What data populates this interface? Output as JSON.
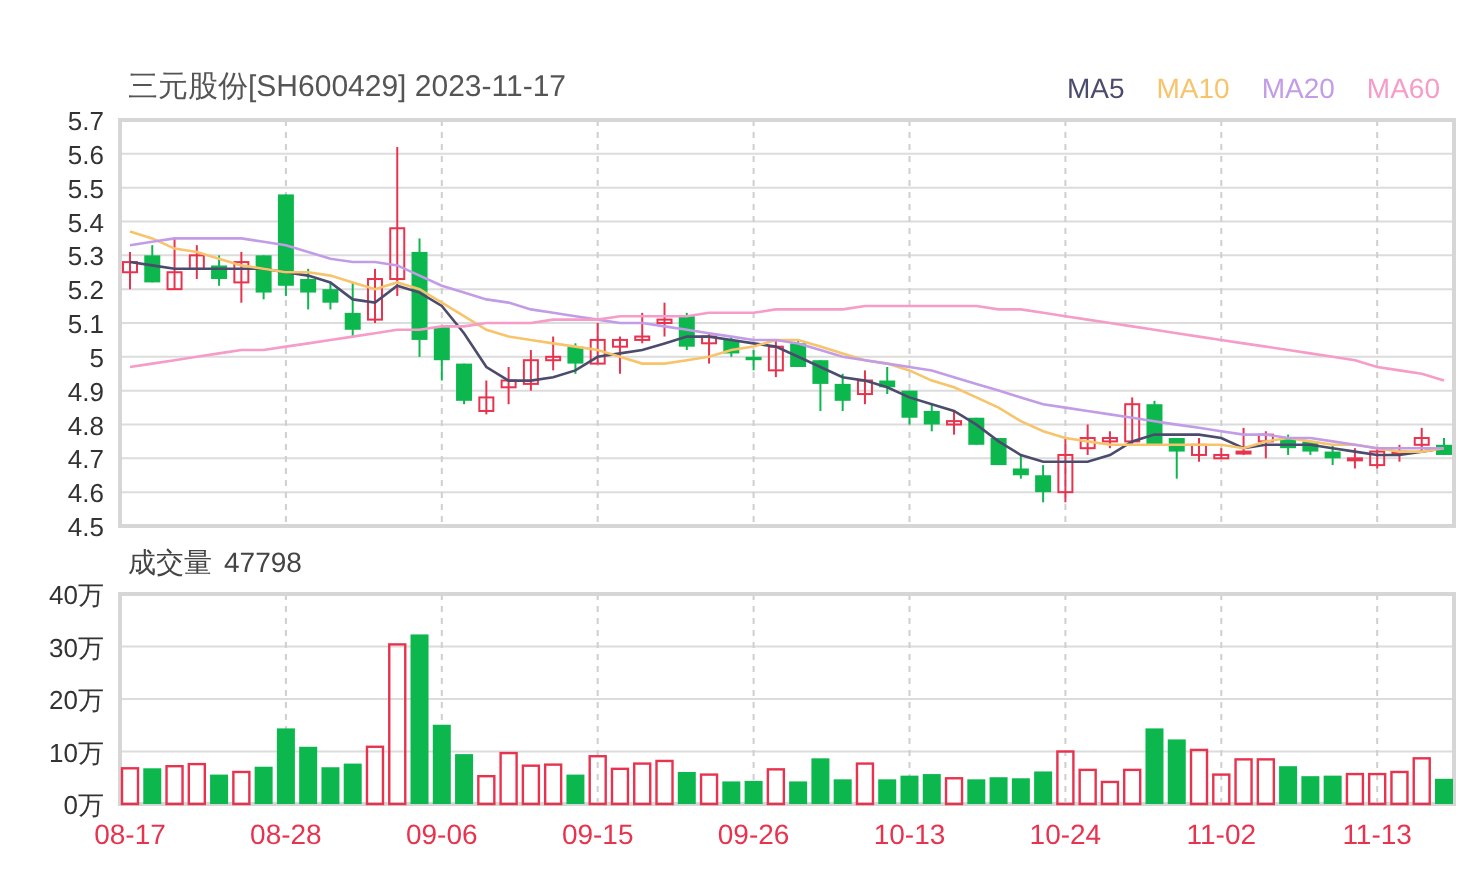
{
  "header": {
    "title": "三元股份[SH600429] 2023-11-17"
  },
  "price_chart": {
    "candles": {
      "chart_data": {
        "type": "candlestick",
        "grid": true,
        "categories": [
          null,
          null,
          null,
          null,
          null,
          null,
          null,
          null,
          null,
          null,
          null,
          null,
          null,
          null,
          null,
          null,
          null,
          null,
          null,
          null,
          null,
          null,
          null,
          null,
          null,
          null,
          null,
          null,
          null,
          null,
          null,
          null,
          null,
          null,
          null,
          null,
          null,
          null,
          null,
          null,
          null,
          null,
          null,
          null,
          null,
          null,
          null,
          null,
          null,
          null,
          null,
          null,
          null,
          null,
          null,
          null,
          null,
          null,
          null,
          null
        ],
        "ylim": [
          4.5,
          5.7
        ],
        "yticks": [
          {
            "value": 5.7,
            "label": "5.7"
          },
          {
            "value": 5.6,
            "label": "5.6"
          },
          {
            "value": 5.5,
            "label": "5.5"
          },
          {
            "value": 5.4,
            "label": "5.4"
          },
          {
            "value": 5.3,
            "label": "5.3"
          },
          {
            "value": 5.2,
            "label": "5.2"
          },
          {
            "value": 5.1,
            "label": "5.1"
          },
          {
            "value": 5,
            "label": "5"
          },
          {
            "value": 4.9,
            "label": "4.9"
          },
          {
            "value": 4.8,
            "label": "4.8"
          },
          {
            "value": 4.7,
            "label": "4.7"
          },
          {
            "value": 4.6,
            "label": "4.6"
          },
          {
            "value": 4.5,
            "label": "4.5"
          }
        ],
        "ohlc": [
          [
            5.25,
            5.31,
            5.2,
            5.28
          ],
          [
            5.3,
            5.33,
            5.22,
            5.22
          ],
          [
            5.2,
            5.35,
            5.2,
            5.25
          ],
          [
            5.26,
            5.33,
            5.23,
            5.3
          ],
          [
            5.27,
            5.3,
            5.21,
            5.23
          ],
          [
            5.22,
            5.31,
            5.16,
            5.28
          ],
          [
            5.3,
            5.3,
            5.17,
            5.19
          ],
          [
            5.48,
            5.48,
            5.18,
            5.21
          ],
          [
            5.23,
            5.26,
            5.14,
            5.19
          ],
          [
            5.2,
            5.22,
            5.14,
            5.16
          ],
          [
            5.13,
            5.22,
            5.06,
            5.08
          ],
          [
            5.11,
            5.26,
            5.1,
            5.23
          ],
          [
            5.23,
            5.62,
            5.18,
            5.38
          ],
          [
            5.31,
            5.35,
            5.0,
            5.05
          ],
          [
            5.09,
            5.09,
            4.93,
            4.99
          ],
          [
            4.98,
            4.98,
            4.86,
            4.87
          ],
          [
            4.84,
            4.93,
            4.83,
            4.88
          ],
          [
            4.91,
            4.97,
            4.86,
            4.93
          ],
          [
            4.92,
            5.02,
            4.9,
            4.99
          ],
          [
            4.99,
            5.06,
            4.96,
            5.0
          ],
          [
            5.03,
            5.04,
            4.95,
            4.98
          ],
          [
            4.98,
            5.1,
            4.98,
            5.05
          ],
          [
            5.03,
            5.06,
            4.95,
            5.05
          ],
          [
            5.05,
            5.13,
            5.04,
            5.06
          ],
          [
            5.1,
            5.16,
            5.06,
            5.11
          ],
          [
            5.12,
            5.13,
            5.02,
            5.03
          ],
          [
            5.04,
            5.07,
            4.98,
            5.06
          ],
          [
            5.05,
            5.06,
            5.0,
            5.01
          ],
          [
            5.0,
            5.02,
            4.96,
            4.99
          ],
          [
            4.96,
            5.05,
            4.94,
            5.03
          ],
          [
            5.04,
            5.05,
            4.97,
            4.97
          ],
          [
            4.99,
            4.99,
            4.84,
            4.92
          ],
          [
            4.92,
            4.95,
            4.84,
            4.87
          ],
          [
            4.89,
            4.96,
            4.86,
            4.93
          ],
          [
            4.93,
            4.97,
            4.89,
            4.91
          ],
          [
            4.9,
            4.9,
            4.8,
            4.82
          ],
          [
            4.84,
            4.86,
            4.78,
            4.8
          ],
          [
            4.8,
            4.84,
            4.77,
            4.81
          ],
          [
            4.82,
            4.82,
            4.74,
            4.74
          ],
          [
            4.76,
            4.76,
            4.68,
            4.68
          ],
          [
            4.67,
            4.71,
            4.64,
            4.65
          ],
          [
            4.65,
            4.68,
            4.57,
            4.6
          ],
          [
            4.6,
            4.76,
            4.57,
            4.71
          ],
          [
            4.73,
            4.8,
            4.71,
            4.76
          ],
          [
            4.75,
            4.78,
            4.73,
            4.76
          ],
          [
            4.75,
            4.88,
            4.74,
            4.86
          ],
          [
            4.86,
            4.87,
            4.74,
            4.74
          ],
          [
            4.76,
            4.76,
            4.64,
            4.72
          ],
          [
            4.71,
            4.76,
            4.69,
            4.74
          ],
          [
            4.7,
            4.73,
            4.7,
            4.71
          ],
          [
            4.72,
            4.79,
            4.71,
            4.72
          ],
          [
            4.75,
            4.78,
            4.7,
            4.77
          ],
          [
            4.76,
            4.77,
            4.71,
            4.73
          ],
          [
            4.75,
            4.75,
            4.71,
            4.72
          ],
          [
            4.72,
            4.74,
            4.68,
            4.7
          ],
          [
            4.7,
            4.73,
            4.67,
            4.7
          ],
          [
            4.68,
            4.73,
            4.67,
            4.72
          ],
          [
            4.72,
            4.74,
            4.69,
            4.72
          ],
          [
            4.74,
            4.79,
            4.72,
            4.76
          ],
          [
            4.74,
            4.76,
            4.71,
            4.71
          ]
        ]
      }
    },
    "moving_averages": {
      "chart_data": {
        "type": "line",
        "categories": [
          null,
          null,
          null,
          null,
          null,
          null,
          null,
          null,
          null,
          null,
          null,
          null,
          null,
          null,
          null,
          null,
          null,
          null,
          null,
          null,
          null,
          null,
          null,
          null,
          null,
          null,
          null,
          null,
          null,
          null,
          null,
          null,
          null,
          null,
          null,
          null,
          null,
          null,
          null,
          null,
          null,
          null,
          null,
          null,
          null,
          null,
          null,
          null,
          null,
          null,
          null,
          null,
          null,
          null,
          null,
          null,
          null,
          null,
          null,
          null
        ],
        "ylim": [
          4.5,
          5.7
        ],
        "series": [
          {
            "name": "MA5",
            "color": "#4b4b6e",
            "values": [
              5.28,
              5.27,
              5.26,
              5.26,
              5.26,
              5.26,
              5.26,
              5.25,
              5.24,
              5.22,
              5.17,
              5.16,
              5.21,
              5.19,
              5.15,
              5.07,
              4.97,
              4.93,
              4.93,
              4.94,
              4.96,
              5.0,
              5.01,
              5.02,
              5.04,
              5.06,
              5.06,
              5.05,
              5.04,
              5.03,
              5.0,
              4.97,
              4.94,
              4.93,
              4.91,
              4.88,
              4.86,
              4.84,
              4.8,
              4.75,
              4.71,
              4.69,
              4.69,
              4.69,
              4.71,
              4.75,
              4.77,
              4.77,
              4.77,
              4.76,
              4.73,
              4.74,
              4.74,
              4.74,
              4.73,
              4.72,
              4.71,
              4.71,
              4.72,
              4.73
            ]
          },
          {
            "name": "MA10",
            "color": "#f7c46c",
            "values": [
              5.37,
              5.35,
              5.32,
              5.31,
              5.29,
              5.27,
              5.26,
              5.25,
              5.25,
              5.24,
              5.22,
              5.2,
              5.22,
              5.2,
              5.16,
              5.12,
              5.08,
              5.06,
              5.05,
              5.04,
              5.03,
              5.02,
              5.0,
              4.98,
              4.98,
              4.99,
              5.0,
              5.02,
              5.03,
              5.05,
              5.05,
              5.03,
              5.01,
              4.99,
              4.98,
              4.96,
              4.93,
              4.91,
              4.88,
              4.85,
              4.81,
              4.78,
              4.76,
              4.75,
              4.74,
              4.74,
              4.74,
              4.74,
              4.74,
              4.74,
              4.73,
              4.75,
              4.76,
              4.75,
              4.74,
              4.74,
              4.73,
              4.72,
              4.72,
              4.73
            ]
          },
          {
            "name": "MA20",
            "color": "#c29ce6",
            "values": [
              5.33,
              5.34,
              5.35,
              5.35,
              5.35,
              5.35,
              5.34,
              5.33,
              5.31,
              5.29,
              5.28,
              5.28,
              5.27,
              5.24,
              5.21,
              5.19,
              5.17,
              5.16,
              5.14,
              5.13,
              5.12,
              5.11,
              5.1,
              5.1,
              5.09,
              5.08,
              5.07,
              5.06,
              5.05,
              5.05,
              5.04,
              5.02,
              5.0,
              4.99,
              4.98,
              4.97,
              4.96,
              4.94,
              4.92,
              4.9,
              4.88,
              4.86,
              4.85,
              4.84,
              4.83,
              4.82,
              4.81,
              4.8,
              4.79,
              4.78,
              4.77,
              4.77,
              4.76,
              4.76,
              4.75,
              4.74,
              4.73,
              4.73,
              4.73,
              4.73
            ]
          },
          {
            "name": "MA60",
            "color": "#f59cc8",
            "values": [
              4.97,
              4.98,
              4.99,
              5.0,
              5.01,
              5.02,
              5.02,
              5.03,
              5.04,
              5.05,
              5.06,
              5.07,
              5.08,
              5.08,
              5.09,
              5.09,
              5.1,
              5.1,
              5.1,
              5.11,
              5.11,
              5.11,
              5.12,
              5.12,
              5.12,
              5.12,
              5.13,
              5.13,
              5.13,
              5.14,
              5.14,
              5.14,
              5.14,
              5.15,
              5.15,
              5.15,
              5.15,
              5.15,
              5.15,
              5.14,
              5.14,
              5.13,
              5.12,
              5.11,
              5.1,
              5.09,
              5.08,
              5.07,
              5.06,
              5.05,
              5.04,
              5.03,
              5.02,
              5.01,
              5.0,
              4.99,
              4.97,
              4.96,
              4.95,
              4.93
            ]
          }
        ]
      }
    }
  },
  "volume_panel": {
    "latest_volume": "47798",
    "chart_data": {
      "type": "bar",
      "title": "成交量",
      "grid": true,
      "categories": [
        "08-17",
        null,
        null,
        null,
        null,
        null,
        null,
        "08-28",
        null,
        null,
        null,
        null,
        null,
        null,
        "09-06",
        null,
        null,
        null,
        null,
        null,
        null,
        "09-15",
        null,
        null,
        null,
        null,
        null,
        null,
        "09-26",
        null,
        null,
        null,
        null,
        null,
        null,
        "10-13",
        null,
        null,
        null,
        null,
        null,
        null,
        "10-24",
        null,
        null,
        null,
        null,
        null,
        null,
        "11-02",
        null,
        null,
        null,
        null,
        null,
        null,
        "11-13",
        null,
        null,
        null
      ],
      "ylim": [
        0,
        40
      ],
      "yticks": [
        {
          "value": 40,
          "label": "40万"
        },
        {
          "value": 30,
          "label": "30万"
        },
        {
          "value": 20,
          "label": "20万"
        },
        {
          "value": 10,
          "label": "10万"
        },
        {
          "value": 0,
          "label": "0万"
        }
      ],
      "values": [
        6.8,
        6.8,
        7.2,
        7.6,
        5.6,
        6.1,
        7.1,
        14.4,
        10.9,
        7.0,
        7.7,
        10.9,
        30.4,
        32.3,
        15.1,
        9.5,
        5.3,
        9.7,
        7.3,
        7.5,
        5.6,
        9.1,
        6.7,
        7.7,
        8.2,
        6.1,
        5.6,
        4.3,
        4.4,
        6.6,
        4.3,
        8.7,
        4.7,
        7.7,
        4.7,
        5.4,
        5.7,
        4.9,
        4.7,
        5.1,
        4.9,
        6.2,
        10.0,
        6.5,
        4.2,
        6.5,
        14.4,
        12.3,
        10.3,
        5.6,
        8.5,
        8.5,
        7.2,
        5.3,
        5.4,
        5.7,
        5.7,
        6.1,
        8.7,
        4.8
      ]
    }
  }
}
